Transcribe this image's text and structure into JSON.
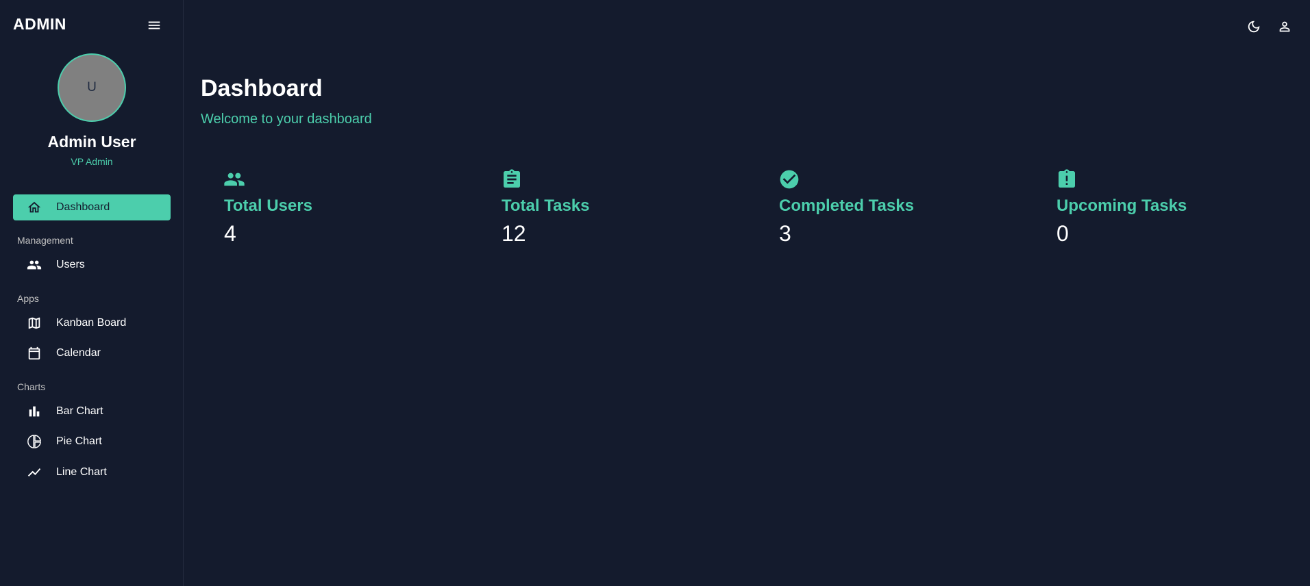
{
  "brand": "ADMIN",
  "profile": {
    "initial": "U",
    "name": "Admin User",
    "role": "VP Admin"
  },
  "nav": {
    "active": {
      "label": "Dashboard",
      "icon": "home-icon"
    },
    "sections": [
      {
        "title": "Management",
        "items": [
          {
            "label": "Users",
            "icon": "people-icon"
          }
        ]
      },
      {
        "title": "Apps",
        "items": [
          {
            "label": "Kanban Board",
            "icon": "map-icon"
          },
          {
            "label": "Calendar",
            "icon": "calendar-icon"
          }
        ]
      },
      {
        "title": "Charts",
        "items": [
          {
            "label": "Bar Chart",
            "icon": "bar-chart-icon"
          },
          {
            "label": "Pie Chart",
            "icon": "pie-chart-icon"
          },
          {
            "label": "Line Chart",
            "icon": "line-chart-icon"
          }
        ]
      }
    ]
  },
  "topbar": {
    "icons": [
      "dark-mode-icon",
      "person-icon"
    ]
  },
  "page": {
    "title": "Dashboard",
    "subtitle": "Welcome to your dashboard"
  },
  "stats": [
    {
      "title": "Total Users",
      "value": "4",
      "icon": "people-icon"
    },
    {
      "title": "Total Tasks",
      "value": "12",
      "icon": "clipboard-icon"
    },
    {
      "title": "Completed Tasks",
      "value": "3",
      "icon": "check-circle-icon"
    },
    {
      "title": "Upcoming Tasks",
      "value": "0",
      "icon": "clipboard-alert-icon"
    }
  ],
  "colors": {
    "background": "#141b2d",
    "accent": "#4cceac",
    "text": "#ffffff",
    "muted": "#c2c2c2"
  }
}
